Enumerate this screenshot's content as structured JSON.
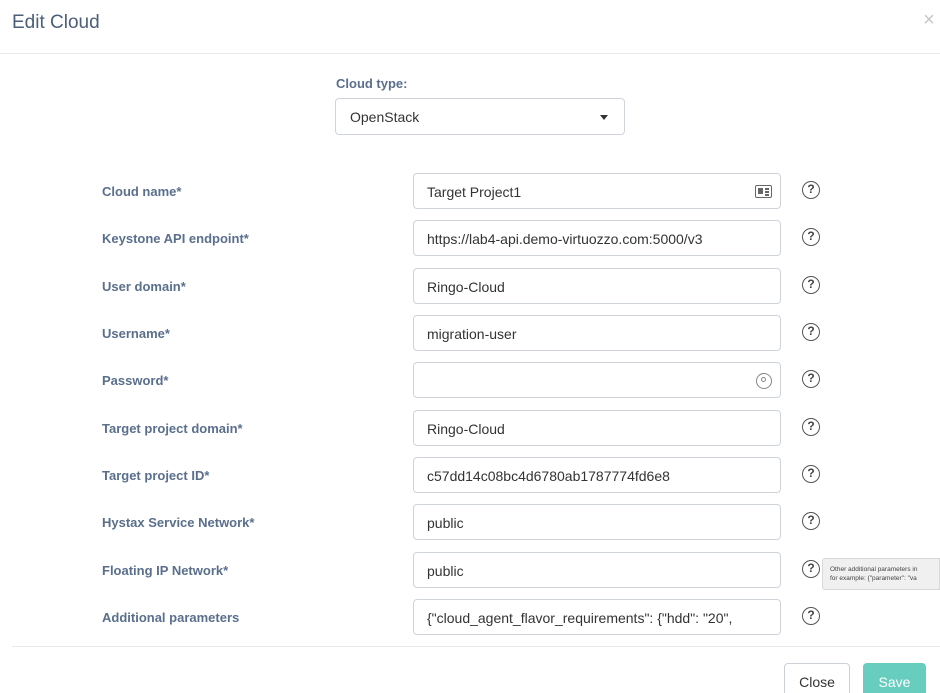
{
  "modal": {
    "title": "Edit Cloud",
    "close_glyph": "×"
  },
  "cloud_type": {
    "label": "Cloud type:",
    "value": "OpenStack"
  },
  "fields": [
    {
      "label": "Cloud name*",
      "value": "Target Project1"
    },
    {
      "label": "Keystone API endpoint*",
      "value": "https://lab4-api.demo-virtuozzo.com:5000/v3"
    },
    {
      "label": "User domain*",
      "value": "Ringo-Cloud"
    },
    {
      "label": "Username*",
      "value": "migration-user"
    },
    {
      "label": "Password*",
      "value": ""
    },
    {
      "label": "Target project domain*",
      "value": "Ringo-Cloud"
    },
    {
      "label": "Target project ID*",
      "value": "c57dd14c08bc4d6780ab1787774fd6e8"
    },
    {
      "label": "Hystax Service Network*",
      "value": "public"
    },
    {
      "label": "Floating IP Network*",
      "value": "public"
    },
    {
      "label": "Additional parameters",
      "value": "{\"cloud_agent_flavor_requirements\": {\"hdd\": \"20\","
    }
  ],
  "help_glyph": "?",
  "tooltip": {
    "line1": "Other additional parameters in",
    "line2": "for example: {\"parameter\": \"va"
  },
  "footer": {
    "close_label": "Close",
    "save_label": "Save"
  },
  "colors": {
    "label": "#5a6f8c",
    "accent": "#67cdbf",
    "title": "#4b5f7a"
  }
}
